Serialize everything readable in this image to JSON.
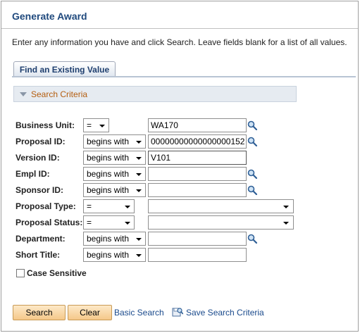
{
  "page": {
    "title": "Generate Award",
    "instructions": "Enter any information you have and click Search. Leave fields blank for a list of all values."
  },
  "tabs": [
    {
      "label": "Find an Existing Value",
      "active": true
    }
  ],
  "criteria_section": {
    "label": "Search Criteria",
    "icon": "collapse-triangle-icon"
  },
  "fields": {
    "business_unit": {
      "label": "Business Unit:",
      "operator": "=",
      "value": "WA170"
    },
    "proposal_id": {
      "label": "Proposal ID:",
      "operator": "begins with",
      "value": "00000000000000000152"
    },
    "version_id": {
      "label": "Version ID:",
      "operator": "begins with",
      "value": "V101"
    },
    "empl_id": {
      "label": "Empl ID:",
      "operator": "begins with",
      "value": ""
    },
    "sponsor_id": {
      "label": "Sponsor ID:",
      "operator": "begins with",
      "value": ""
    },
    "proposal_type": {
      "label": "Proposal Type:",
      "operator": "=",
      "value": ""
    },
    "proposal_status": {
      "label": "Proposal Status:",
      "operator": "=",
      "value": ""
    },
    "department": {
      "label": "Department:",
      "operator": "begins with",
      "value": ""
    },
    "short_title": {
      "label": "Short Title:",
      "operator": "begins with",
      "value": ""
    }
  },
  "case_sensitive": {
    "label": "Case Sensitive",
    "checked": false
  },
  "actions": {
    "search_label": "Search",
    "clear_label": "Clear",
    "basic_search_label": "Basic Search",
    "save_criteria_label": "Save Search Criteria"
  },
  "colors": {
    "title": "#1f497d",
    "section_label": "#b45d0f",
    "button_bg": "#f5c889",
    "link": "#1a4a8c"
  }
}
